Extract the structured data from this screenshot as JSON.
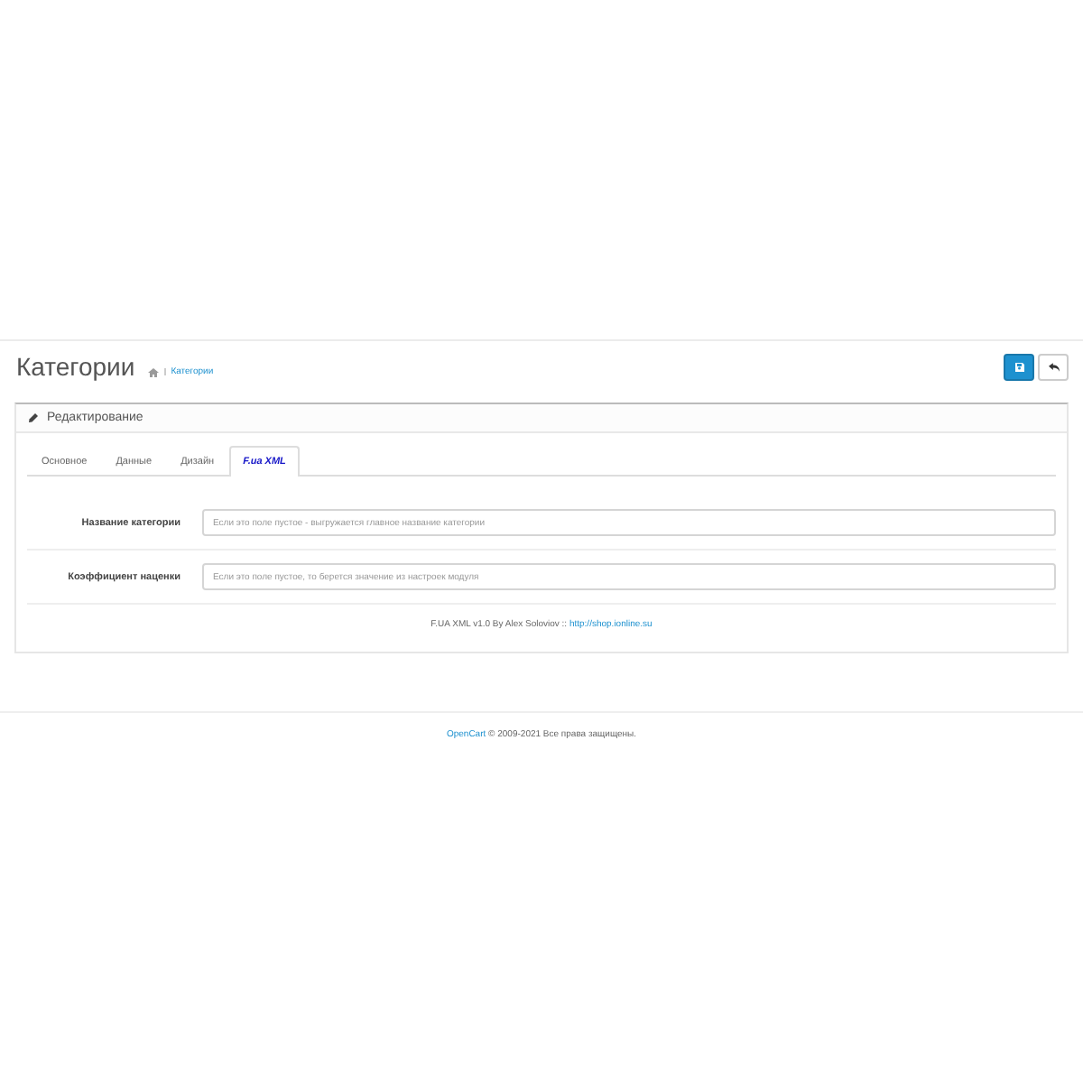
{
  "page_header": {
    "title": "Категории",
    "breadcrumbs": [
      {
        "label": "Категории"
      }
    ]
  },
  "panel": {
    "title": "Редактирование",
    "tabs": [
      {
        "label": "Основное",
        "selected": false
      },
      {
        "label": "Данные",
        "selected": false
      },
      {
        "label": "Дизайн",
        "selected": false
      },
      {
        "label": "F.ua XML",
        "selected": true
      }
    ],
    "fields": [
      {
        "label": "Название категории",
        "placeholder": "Если это поле пустое - выгружается главное название категории"
      },
      {
        "label": "Коэффициент наценки",
        "placeholder": "Если это поле пустое, то берется значение из настроек модуля"
      }
    ],
    "credit": {
      "text": "F.UA XML v1.0 By Alex Soloviov ::",
      "link": "http://shop.ionline.su"
    }
  },
  "footer": {
    "link": "OpenCart",
    "text": "© 2009-2021 Все права защищены."
  }
}
